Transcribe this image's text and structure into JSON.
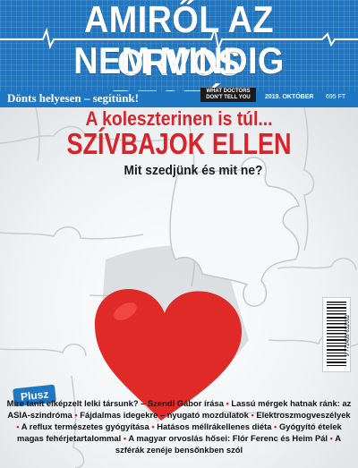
{
  "masthead": {
    "title_line1": "AMIRŐL AZ ORVOS",
    "title_line2": "NEM MINDIG BESZÉL",
    "slogan": "Dönts helyesen – segítünk!",
    "logo_line1": "WHAT DOCTORS",
    "logo_line2": "DON'T TELL YOU",
    "issue_date": "2019. OKTÓBER",
    "price": "695 FT",
    "colors": {
      "brand_blue": "#1f76c2",
      "headline_red": "#d8232a",
      "heart_red": "#e02a28"
    }
  },
  "cover": {
    "headline1": "A koleszterinen is túl...",
    "headline2": "SZÍVBAJOK ELLEN",
    "headline3": "Mit szedjünk és mit ne?",
    "barcode_number": "9 772498 832002",
    "barcode_side": "19010"
  },
  "plus": {
    "label": "Plusz",
    "items": [
      "Mire tanít elképzelt lelki társunk? – Szendi Gábor írása",
      "Lassú mérgek hatnak ránk: az ASIA-szindróma",
      "Fájdalmas idegekre – nyugató mozdulatok",
      "Elektroszmogveszélyek",
      "A reflux természetes gyógyítása",
      "Hatásos méllrákellenes diéta",
      "Gyógyító ételek magas fehérjetartalommal",
      "A magyar orvoslás hősei: Flór Ferenc és Heim Pál",
      "A szférák zenéje bensőnkben szól"
    ]
  }
}
